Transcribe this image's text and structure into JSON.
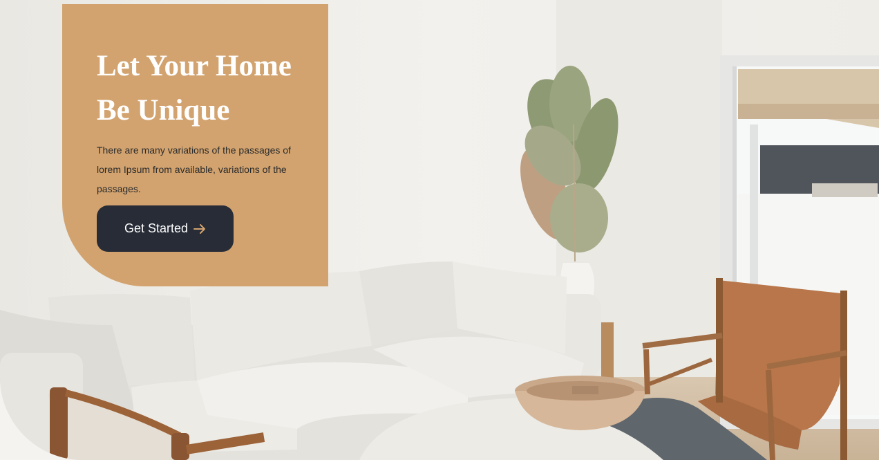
{
  "hero": {
    "title_line1": "Let Your Home",
    "title_line2": "Be Unique",
    "description": "There are many variations of the passages of lorem Ipsum from available, variations of the passages.",
    "cta_label": "Get Started",
    "cta_icon": "arrow-right-icon"
  },
  "colors": {
    "card": "#d2a36f",
    "button": "#272c37",
    "accent": "#d2a36f",
    "wall": "#f1efea"
  }
}
